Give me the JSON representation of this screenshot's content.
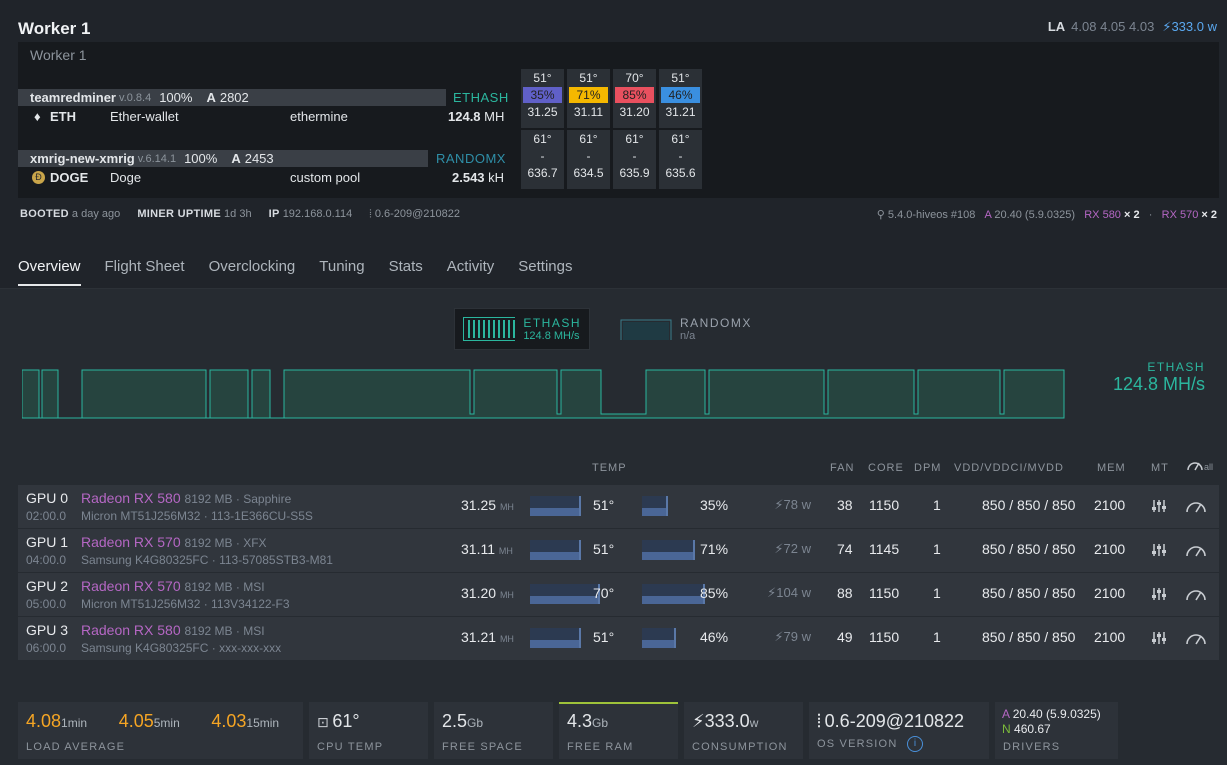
{
  "header": {
    "title": "Worker 1",
    "la_label": "LA",
    "la_values": "4.08 4.05 4.03",
    "power": "333.0 w"
  },
  "panel": {
    "subtitle": "Worker 1",
    "miners": [
      {
        "name": "teamredminer",
        "version": "v.0.8.4",
        "percent": "100%",
        "accepted_label": "A",
        "accepted": "2802",
        "algo": "ETHASH",
        "coin": "ETH",
        "wallet": "Ether-wallet",
        "pool": "ethermine",
        "hashrate": "124.8",
        "hash_unit": "MH",
        "gpus": [
          {
            "temp": "51°",
            "fan": "35%",
            "fan_color": "#6060c8",
            "hash": "31.25"
          },
          {
            "temp": "51°",
            "fan": "71%",
            "fan_color": "#f5b800",
            "hash": "31.11"
          },
          {
            "temp": "70°",
            "fan": "85%",
            "fan_color": "#e9505f",
            "hash": "31.20"
          },
          {
            "temp": "51°",
            "fan": "46%",
            "fan_color": "#3a8fe0",
            "hash": "31.21"
          }
        ]
      },
      {
        "name": "xmrig-new-xmrig",
        "version": "v.6.14.1",
        "percent": "100%",
        "accepted_label": "A",
        "accepted": "2453",
        "algo": "RANDOMX",
        "coin": "DOGE",
        "wallet": "Doge",
        "pool": "custom pool",
        "hashrate": "2.543",
        "hash_unit": "kH",
        "gpus": [
          {
            "temp": "61°",
            "fan": "-",
            "hash": "636.7"
          },
          {
            "temp": "61°",
            "fan": "-",
            "hash": "634.5"
          },
          {
            "temp": "61°",
            "fan": "-",
            "hash": "635.9"
          },
          {
            "temp": "61°",
            "fan": "-",
            "hash": "635.6"
          }
        ]
      }
    ]
  },
  "info": {
    "booted_label": "BOOTED",
    "booted": "a day ago",
    "uptime_label": "MINER UPTIME",
    "uptime": "1d 3h",
    "ip_label": "IP",
    "ip": "192.168.0.114",
    "os": "0.6-209@210822",
    "kernel": "5.4.0-hiveos #108",
    "driver_label": "A",
    "driver": "20.40 (5.9.0325)",
    "gpu_a": "RX 580",
    "gpu_a_count": "× 2",
    "sep": "·",
    "gpu_b": "RX 570",
    "gpu_b_count": "× 2"
  },
  "tabs": [
    "Overview",
    "Flight Sheet",
    "Overclocking",
    "Tuning",
    "Stats",
    "Activity",
    "Settings"
  ],
  "algo_switch": [
    {
      "label": "ETHASH",
      "value": "124.8 MH/s",
      "active": true
    },
    {
      "label": "RANDOMX",
      "value": "n/a",
      "active": false
    }
  ],
  "chart_right": {
    "label": "ETHASH",
    "value": "124.8 MH/s"
  },
  "table": {
    "headers": {
      "temp": "TEMP",
      "fan": "FAN",
      "core": "CORE",
      "dpm": "DPM",
      "vdd": "VDD/VDDCI/MVDD",
      "mem": "MEM",
      "mt": "MT",
      "all": "all"
    },
    "rows": [
      {
        "gpu": "GPU 0",
        "bus": "02:00.0",
        "model": "Radeon RX 580",
        "vram": "8192 MB · Sapphire",
        "memory": "Micron MT51J256M32 · 113-1E366CU-S5S",
        "hash": "31.25",
        "hash_unit": "MH",
        "temp": "51°",
        "temp_level": 0.51,
        "fan": "35%",
        "fan_level": 0.35,
        "power": "78 w",
        "fan_col": "38",
        "core": "1150",
        "dpm": "1",
        "vdd": "850 / 850 / 850",
        "mem": "2100"
      },
      {
        "gpu": "GPU 1",
        "bus": "04:00.0",
        "model": "Radeon RX 570",
        "vram": "8192 MB · XFX",
        "memory": "Samsung K4G80325FC · 113-57085STB3-M81",
        "hash": "31.11",
        "hash_unit": "MH",
        "temp": "51°",
        "temp_level": 0.51,
        "fan": "71%",
        "fan_level": 0.71,
        "power": "72 w",
        "fan_col": "74",
        "core": "1145",
        "dpm": "1",
        "vdd": "850 / 850 / 850",
        "mem": "2100"
      },
      {
        "gpu": "GPU 2",
        "bus": "05:00.0",
        "model": "Radeon RX 570",
        "vram": "8192 MB · MSI",
        "memory": "Micron MT51J256M32 · 113V34122-F3",
        "hash": "31.20",
        "hash_unit": "MH",
        "temp": "70°",
        "temp_level": 0.7,
        "fan": "85%",
        "fan_level": 0.85,
        "power": "104 w",
        "fan_col": "88",
        "core": "1150",
        "dpm": "1",
        "vdd": "850 / 850 / 850",
        "mem": "2100"
      },
      {
        "gpu": "GPU 3",
        "bus": "06:00.0",
        "model": "Radeon RX 580",
        "vram": "8192 MB · MSI",
        "memory": "Samsung K4G80325FC · xxx-xxx-xxx",
        "hash": "31.21",
        "hash_unit": "MH",
        "temp": "51°",
        "temp_level": 0.51,
        "fan": "46%",
        "fan_level": 0.46,
        "power": "79 w",
        "fan_col": "49",
        "core": "1150",
        "dpm": "1",
        "vdd": "850 / 850 / 850",
        "mem": "2100"
      }
    ]
  },
  "footer": {
    "load": {
      "v1": "4.08",
      "u1": "1min",
      "v5": "4.05",
      "u5": "5min",
      "v15": "4.03",
      "u15": "15min",
      "label": "LOAD AVERAGE"
    },
    "cpu": {
      "value": "61°",
      "label": "CPU TEMP"
    },
    "space": {
      "value": "2.5",
      "unit": "Gb",
      "label": "FREE SPACE"
    },
    "ram": {
      "value": "4.3",
      "unit": "Gb",
      "label": "FREE RAM"
    },
    "consumption": {
      "value": "333.0",
      "unit": "w",
      "label": "CONSUMPTION"
    },
    "os": {
      "value": "0.6-209@210822",
      "label": "OS VERSION"
    },
    "drivers": {
      "a_label": "A",
      "a": "20.40 (5.9.0325)",
      "n_label": "N",
      "n": "460.67",
      "label": "DRIVERS"
    }
  },
  "colors": {
    "accent_teal": "#2bb69e",
    "gpu_purple": "#b567c4",
    "load_orange": "#f5a524",
    "power_blue": "#5aa8ef"
  }
}
